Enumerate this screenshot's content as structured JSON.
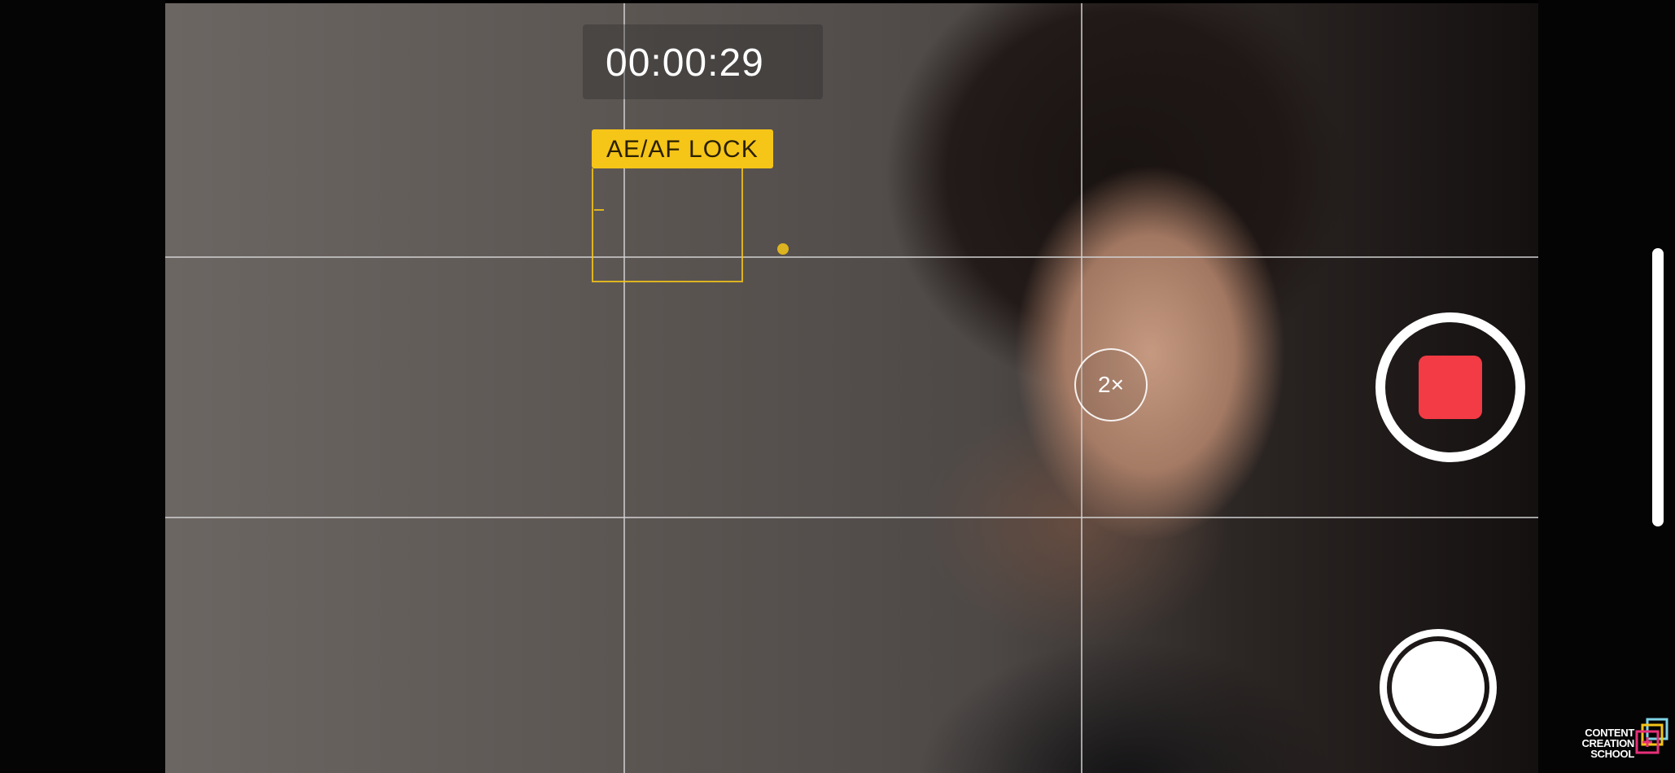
{
  "recording": {
    "timer": "00:00:29",
    "lock_label": "AE/AF LOCK",
    "zoom_label": "2×",
    "record_color": "#f23b44",
    "lock_color": "#f5c518"
  },
  "controls": {
    "record_icon": "stop-square-icon",
    "shutter_icon": "still-shutter-icon",
    "zoom_icon": "zoom-circle-icon"
  },
  "watermark": {
    "line1": "CONTENT",
    "line2": "CREATION",
    "line3": "SCHOOL"
  }
}
